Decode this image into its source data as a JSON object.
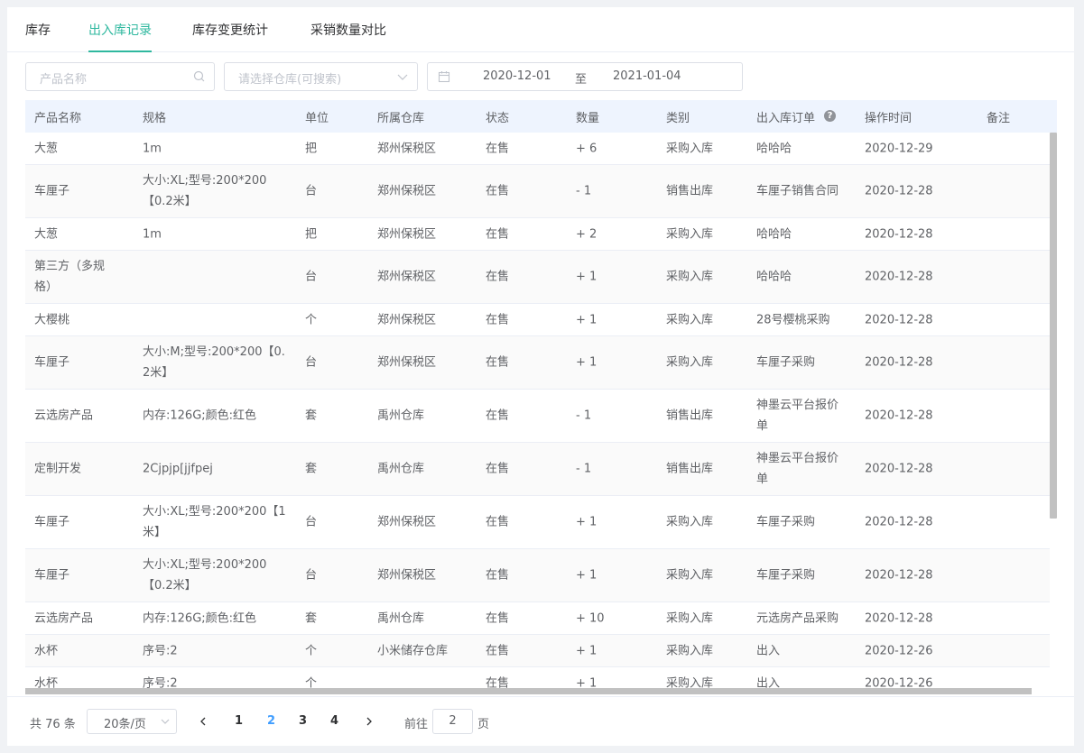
{
  "tabs": [
    "库存",
    "出入库记录",
    "库存变更统计",
    "采销数量对比"
  ],
  "active_tab": 1,
  "filters": {
    "product_placeholder": "产品名称",
    "warehouse_placeholder": "请选择仓库(可搜索)",
    "date_start": "2020-12-01",
    "date_sep": "至",
    "date_end": "2021-01-04"
  },
  "columns": [
    "产品名称",
    "规格",
    "单位",
    "所属仓库",
    "状态",
    "数量",
    "类别",
    "出入库订单",
    "操作时间",
    "备注"
  ],
  "rows": [
    {
      "name": "大葱",
      "spec": "1m",
      "unit": "把",
      "warehouse": "郑州保税区",
      "status": "在售",
      "qty": "+ 6",
      "type": "采购入库",
      "order": "哈哈哈",
      "time": "2020-12-29",
      "note": ""
    },
    {
      "name": "车厘子",
      "spec": "大小:XL;型号:200*200\n【0.2米】",
      "unit": "台",
      "warehouse": "郑州保税区",
      "status": "在售",
      "qty": "- 1",
      "type": "销售出库",
      "order": "车厘子销售合同",
      "time": "2020-12-28",
      "note": ""
    },
    {
      "name": "大葱",
      "spec": "1m",
      "unit": "把",
      "warehouse": "郑州保税区",
      "status": "在售",
      "qty": "+ 2",
      "type": "采购入库",
      "order": "哈哈哈",
      "time": "2020-12-28",
      "note": ""
    },
    {
      "name": "第三方（多规\n格）",
      "spec": "",
      "unit": "台",
      "warehouse": "郑州保税区",
      "status": "在售",
      "qty": "+ 1",
      "type": "采购入库",
      "order": "哈哈哈",
      "time": "2020-12-28",
      "note": ""
    },
    {
      "name": "大樱桃",
      "spec": "",
      "unit": "个",
      "warehouse": "郑州保税区",
      "status": "在售",
      "qty": "+ 1",
      "type": "采购入库",
      "order": "28号樱桃采购",
      "time": "2020-12-28",
      "note": ""
    },
    {
      "name": "车厘子",
      "spec": "大小:M;型号:200*200【0.\n2米】",
      "unit": "台",
      "warehouse": "郑州保税区",
      "status": "在售",
      "qty": "+ 1",
      "type": "采购入库",
      "order": "车厘子采购",
      "time": "2020-12-28",
      "note": ""
    },
    {
      "name": "云选房产品",
      "spec": "内存:126G;颜色:红色",
      "unit": "套",
      "warehouse": "禹州仓库",
      "status": "在售",
      "qty": "- 1",
      "type": "销售出库",
      "order": "神墨云平台报价\n单",
      "time": "2020-12-28",
      "note": ""
    },
    {
      "name": "定制开发",
      "spec": "2Cjpjp[jjfpej",
      "unit": "套",
      "warehouse": "禹州仓库",
      "status": "在售",
      "qty": "- 1",
      "type": "销售出库",
      "order": "神墨云平台报价\n单",
      "time": "2020-12-28",
      "note": ""
    },
    {
      "name": "车厘子",
      "spec": "大小:XL;型号:200*200【1\n米】",
      "unit": "台",
      "warehouse": "郑州保税区",
      "status": "在售",
      "qty": "+ 1",
      "type": "采购入库",
      "order": "车厘子采购",
      "time": "2020-12-28",
      "note": ""
    },
    {
      "name": "车厘子",
      "spec": "大小:XL;型号:200*200\n【0.2米】",
      "unit": "台",
      "warehouse": "郑州保税区",
      "status": "在售",
      "qty": "+ 1",
      "type": "采购入库",
      "order": "车厘子采购",
      "time": "2020-12-28",
      "note": ""
    },
    {
      "name": "云选房产品",
      "spec": "内存:126G;颜色:红色",
      "unit": "套",
      "warehouse": "禹州仓库",
      "status": "在售",
      "qty": "+ 10",
      "type": "采购入库",
      "order": "元选房产品采购",
      "time": "2020-12-28",
      "note": ""
    },
    {
      "name": "水杯",
      "spec": "序号:2",
      "unit": "个",
      "warehouse": "小米储存仓库",
      "status": "在售",
      "qty": "+ 1",
      "type": "采购入库",
      "order": "出入",
      "time": "2020-12-26",
      "note": ""
    },
    {
      "name": "水杯",
      "spec": "序号:2",
      "unit": "个",
      "warehouse": "",
      "status": "在售",
      "qty": "+ 1",
      "type": "采购入库",
      "order": "出入",
      "time": "2020-12-26",
      "note": ""
    }
  ],
  "pagination": {
    "total_text": "共 76 条",
    "page_size": "20条/页",
    "pages": [
      "1",
      "2",
      "3",
      "4"
    ],
    "current_page": "2",
    "goto_label": "前往",
    "goto_value": "2",
    "goto_suffix": "页"
  }
}
